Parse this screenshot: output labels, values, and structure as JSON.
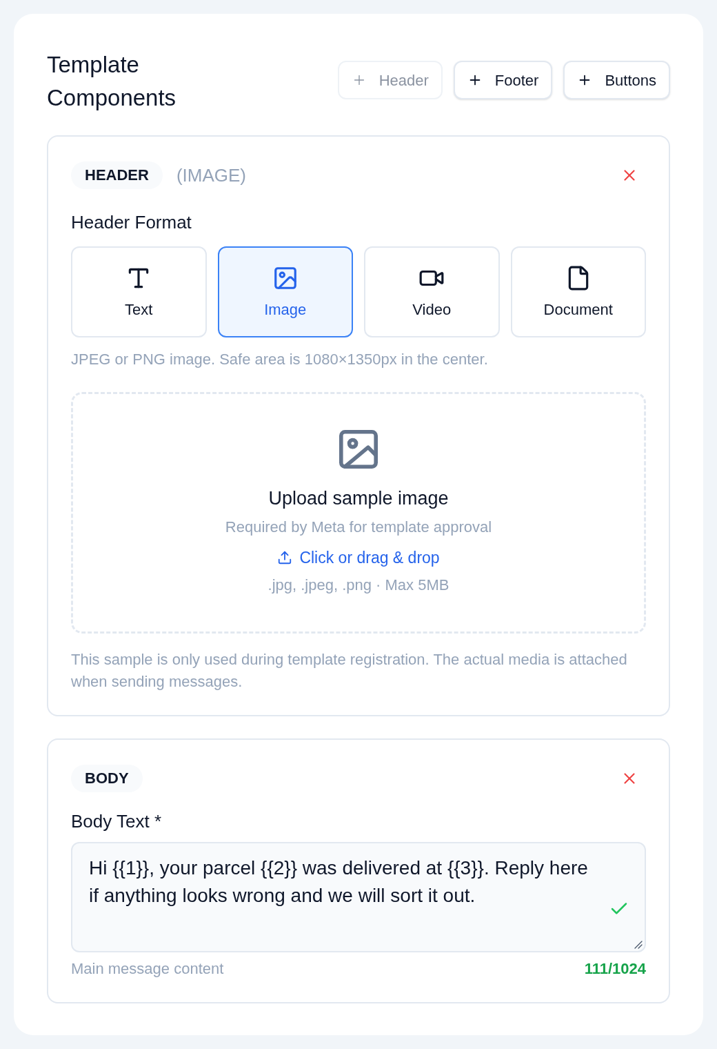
{
  "title": "Template Components",
  "add_buttons": [
    {
      "label": "Header",
      "disabled": true
    },
    {
      "label": "Footer",
      "disabled": false
    },
    {
      "label": "Buttons",
      "disabled": false
    }
  ],
  "sections": [
    {
      "kind": "header",
      "badge": "HEADER",
      "subtype": "(IMAGE)",
      "field_label": "Header Format",
      "formats": [
        {
          "kind": "text",
          "label": "Text",
          "selected": false
        },
        {
          "kind": "image",
          "label": "Image",
          "selected": true
        },
        {
          "kind": "video",
          "label": "Video",
          "selected": false
        },
        {
          "kind": "document",
          "label": "Document",
          "selected": false
        }
      ],
      "format_hint": "JPEG or PNG image. Safe area is 1080×1350px in the center.",
      "upload": {
        "title": "Upload sample image",
        "subtitle": "Required by Meta for template approval",
        "link": "Click or drag & drop",
        "accepted": ".jpg, .jpeg, .png · Max 5MB"
      },
      "note": "This sample is only used during template registration. The actual media is attached when sending messages."
    },
    {
      "kind": "body",
      "badge": "BODY",
      "field_label": "Body Text *",
      "value": "Hi {{1}}, your parcel {{2}} was delivered at {{3}}. Reply here if anything looks wrong and we will sort it out.",
      "valid": true,
      "helper": "Main message content",
      "counter": "111/1024"
    }
  ]
}
